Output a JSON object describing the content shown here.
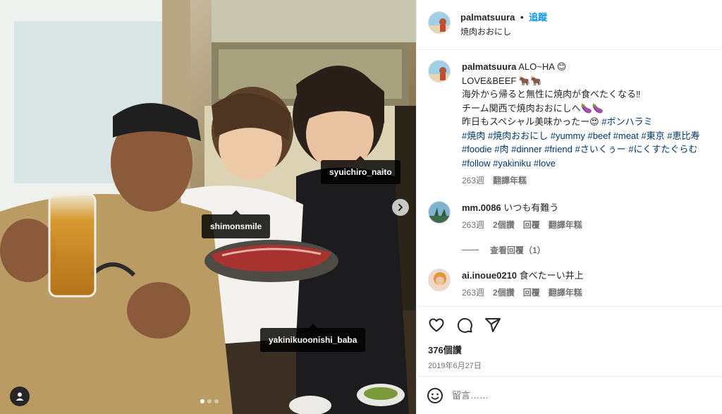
{
  "post": {
    "author": "palmatsuura",
    "separator": "•",
    "follow_label": "追蹤",
    "location": "焼肉おおにし"
  },
  "photo": {
    "tags": [
      {
        "username": "syuichiro_naito"
      },
      {
        "username": "shimonsmile"
      },
      {
        "username": "yakinikuoonishi_baba"
      }
    ],
    "carousel": {
      "count": 3,
      "active_index": 0
    }
  },
  "caption": {
    "username": "palmatsuura",
    "lines": [
      "ALO~HA 😊",
      "LOVE&BEEF 🐂🐂",
      "海外から帰ると無性に焼肉が食べたくなる‼︎",
      "チーム関西で焼肉おおにしへ🍆🍆",
      "昨日もスペシャル美味かったー😍"
    ],
    "inline_hashtag": "#ボンハラミ",
    "hashtags": [
      "#焼肉",
      "#焼肉おおにし",
      "#yummy",
      "#beef",
      "#meat",
      "#東京",
      "#恵比寿",
      "#foodie",
      "#肉",
      "#dinner",
      "#friend",
      "#さいくぅー",
      "#にくすたぐらむ",
      "#follow",
      "#yakiniku",
      "#love"
    ],
    "age": "263週",
    "translate_label": "翻譯年糕"
  },
  "comments": [
    {
      "username": "mm.0086",
      "text": "いつも有難う",
      "age": "263週",
      "likes": "2個讚",
      "reply_label": "回覆",
      "translate_label": "翻譯年糕",
      "view_replies": "查看回覆（1）"
    },
    {
      "username": "ai.inoue0210",
      "text": "食べたーい井上",
      "age": "263週",
      "likes": "2個讚",
      "reply_label": "回覆",
      "translate_label": "翻譯年糕"
    }
  ],
  "engagement": {
    "likes": "376個讚",
    "date": "2019年6月27日"
  },
  "composer": {
    "placeholder": "留言……"
  },
  "colors": {
    "accent": "#0095f6",
    "hashtag": "#00376b",
    "muted": "#737373",
    "border": "#efefef"
  },
  "icons": [
    "heart-icon",
    "comment-icon",
    "share-icon",
    "emoji-icon",
    "chevron-right-icon",
    "user-tag-icon"
  ]
}
